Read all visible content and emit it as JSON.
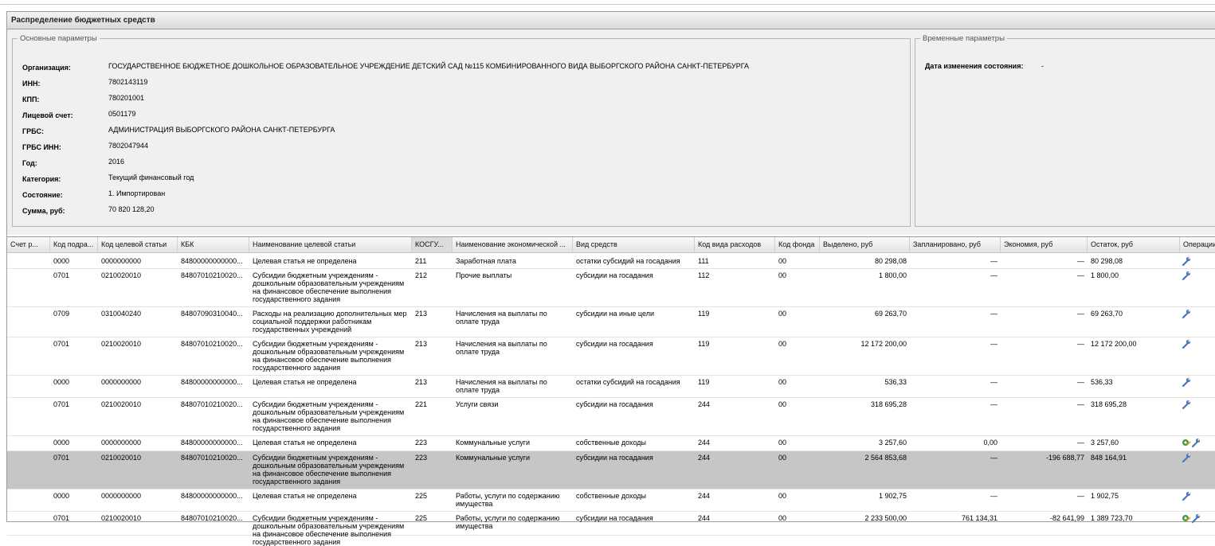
{
  "panel": {
    "title": "Распределение бюджетных средств"
  },
  "main_params": {
    "legend": "Основные параметры",
    "fields": [
      {
        "label": "Организация:",
        "value": "ГОСУДАРСТВЕННОЕ БЮДЖЕТНОЕ ДОШКОЛЬНОЕ ОБРАЗОВАТЕЛЬНОЕ УЧРЕЖДЕНИЕ ДЕТСКИЙ САД №115 КОМБИНИРОВАННОГО ВИДА ВЫБОРГСКОГО РАЙОНА САНКТ-ПЕТЕРБУРГА"
      },
      {
        "label": "ИНН:",
        "value": "7802143119"
      },
      {
        "label": "КПП:",
        "value": "780201001"
      },
      {
        "label": "Лицевой счет:",
        "value": "0501179"
      },
      {
        "label": "ГРБС:",
        "value": "АДМИНИСТРАЦИЯ ВЫБОРГСКОГО РАЙОНА САНКТ-ПЕТЕРБУРГА"
      },
      {
        "label": "ГРБС ИНН:",
        "value": "7802047944"
      },
      {
        "label": "Год:",
        "value": "2016"
      },
      {
        "label": "Категория:",
        "value": "Текущий финансовый год"
      },
      {
        "label": "Состояние:",
        "value": "1. Импортирован"
      },
      {
        "label": "Сумма, руб:",
        "value": "70 820 128,20"
      }
    ]
  },
  "time_params": {
    "legend": "Временные параметры",
    "label": "Дата изменения состояния:",
    "value": "-"
  },
  "grid": {
    "columns": [
      "Счет р...",
      "Код подра...",
      "Код целевой статьи",
      "КБК",
      "Наименование целевой статьи",
      "КОСГУ...",
      "Наименование экономической ...",
      "Вид средств",
      "Код вида расходов",
      "Код фонда",
      "Выделено, руб",
      "Запланировано, руб",
      "Экономия, руб",
      "Остаток, руб",
      "Операции"
    ],
    "rows": [
      {
        "c1": "0000",
        "c2": "0000000000",
        "c3": "84800000000000...",
        "c4": "Целевая статья не определена",
        "c5": "211",
        "c6": "Заработная плата",
        "c7": "остатки субсидий на госадания",
        "c8": "111",
        "c9": "00",
        "c10": "80 298,08",
        "c11": "—",
        "c12": "—",
        "c13": "80 298,08",
        "ops": "wrench"
      },
      {
        "c1": "0701",
        "c2": "0210020010",
        "c3": "84807010210020...",
        "c4": "Субсидии бюджетным учреждениям - дошкольным образовательным учреждениям на финансовое обеспечение выполнения государственного задания",
        "c5": "212",
        "c6": "Прочие выплаты",
        "c7": "субсидии на госадания",
        "c8": "112",
        "c9": "00",
        "c10": "1 800,00",
        "c11": "—",
        "c12": "—",
        "c13": "1 800,00",
        "ops": "wrench"
      },
      {
        "c1": "0709",
        "c2": "0310040240",
        "c3": "84807090310040...",
        "c4": "Расходы на реализацию дополнительных мер социальной поддержки работникам государственных учреждений",
        "c5": "213",
        "c6": "Начисления на выплаты по оплате труда",
        "c7": "субсидии на иные цели",
        "c8": "119",
        "c9": "00",
        "c10": "69 263,70",
        "c11": "—",
        "c12": "—",
        "c13": "69 263,70",
        "ops": "wrench"
      },
      {
        "c1": "0701",
        "c2": "0210020010",
        "c3": "84807010210020...",
        "c4": "Субсидии бюджетным учреждениям - дошкольным образовательным учреждениям на финансовое обеспечение выполнения государственного задания",
        "c5": "213",
        "c6": "Начисления на выплаты по оплате труда",
        "c7": "субсидии на госадания",
        "c8": "119",
        "c9": "00",
        "c10": "12 172 200,00",
        "c11": "—",
        "c12": "—",
        "c13": "12 172 200,00",
        "ops": "wrench"
      },
      {
        "c1": "0000",
        "c2": "0000000000",
        "c3": "84800000000000...",
        "c4": "Целевая статья не определена",
        "c5": "213",
        "c6": "Начисления на выплаты по оплате труда",
        "c7": "остатки субсидий на госадания",
        "c8": "119",
        "c9": "00",
        "c10": "536,33",
        "c11": "—",
        "c12": "—",
        "c13": "536,33",
        "ops": "wrench"
      },
      {
        "c1": "0701",
        "c2": "0210020010",
        "c3": "84807010210020...",
        "c4": "Субсидии бюджетным учреждениям - дошкольным образовательным учреждениям на финансовое обеспечение выполнения государственного задания",
        "c5": "221",
        "c6": "Услуги связи",
        "c7": "субсидии на госадания",
        "c8": "244",
        "c9": "00",
        "c10": "318 695,28",
        "c11": "—",
        "c12": "—",
        "c13": "318 695,28",
        "ops": "wrench"
      },
      {
        "c1": "0000",
        "c2": "0000000000",
        "c3": "84800000000000...",
        "c4": "Целевая статья не определена",
        "c5": "223",
        "c6": "Коммунальные услуги",
        "c7": "собственные доходы",
        "c8": "244",
        "c9": "00",
        "c10": "3 257,60",
        "c11": "0,00",
        "c12": "—",
        "c13": "3 257,60",
        "ops": "both"
      },
      {
        "c1": "0701",
        "c2": "0210020010",
        "c3": "84807010210020...",
        "c4": "Субсидии бюджетным учреждениям - дошкольным образовательным учреждениям на финансовое обеспечение выполнения государственного задания",
        "c5": "223",
        "c6": "Коммунальные услуги",
        "c7": "субсидии на госадания",
        "c8": "244",
        "c9": "00",
        "c10": "2 564 853,68",
        "c11": "—",
        "c12": "-196 688,77",
        "c13": "848 164,91",
        "ops": "wrench"
      },
      {
        "c1": "0000",
        "c2": "0000000000",
        "c3": "84800000000000...",
        "c4": "Целевая статья не определена",
        "c5": "225",
        "c6": "Работы, услуги по содержанию имущества",
        "c7": "собственные доходы",
        "c8": "244",
        "c9": "00",
        "c10": "1 902,75",
        "c11": "—",
        "c12": "—",
        "c13": "1 902,75",
        "ops": "wrench"
      },
      {
        "c1": "0701",
        "c2": "0210020010",
        "c3": "84807010210020...",
        "c4": "Субсидии бюджетным учреждениям - дошкольным образовательным учреждениям на финансовое обеспечение выполнения государственного задания",
        "c5": "225",
        "c6": "Работы, услуги по содержанию имущества",
        "c7": "субсидии на госадания",
        "c8": "244",
        "c9": "00",
        "c10": "2 233 500,00",
        "c11": "761 134,31",
        "c12": "-82 641,99",
        "c13": "1 389 723,70",
        "ops": "both"
      }
    ]
  }
}
